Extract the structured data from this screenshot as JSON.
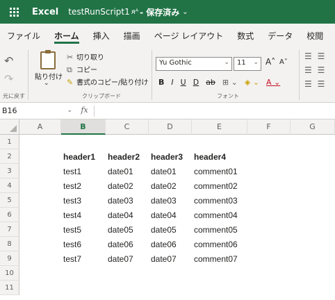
{
  "titlebar": {
    "app": "Excel",
    "doc": "testRunScript1",
    "share_icon": "ᴙᴬ",
    "save_status": "- 保存済み",
    "chevron": "⌄"
  },
  "tabs": [
    "ファイル",
    "ホーム",
    "挿入",
    "描画",
    "ページ レイアウト",
    "数式",
    "データ",
    "校閲"
  ],
  "ribbon": {
    "undo_icon": "↶",
    "redo_icon": "↷",
    "undo_group": "元に戻す",
    "paste": "貼り付け",
    "paste_chev": "⌄",
    "cut": "切り取り",
    "copy": "コピー",
    "format_painter": "書式のコピー/貼り付け",
    "clipboard_group": "クリップボード",
    "font_name": "Yu Gothic",
    "font_size": "11",
    "grow": "A˄",
    "shrink": "A˅",
    "bold": "B",
    "italic": "I",
    "underline": "U",
    "double_underline": "D",
    "strike": "ab",
    "border_icon": "⊞ ⌄",
    "fill_icon": "◈ ⌄",
    "fontcolor_icon": "A ⌄",
    "font_group": "フォント",
    "align_top": "☰ ☰",
    "align_mid": "☰ ☰",
    "align_bot": "☰ ☰"
  },
  "formulabar": {
    "cell": "B16",
    "dd": "⌄",
    "fx": "fx",
    "value": ""
  },
  "columns": [
    "A",
    "B",
    "C",
    "D",
    "E",
    "F",
    "G"
  ],
  "selected_column": "B",
  "rows": [
    "1",
    "2",
    "3",
    "4",
    "5",
    "6",
    "7",
    "8",
    "9",
    "10",
    "11"
  ],
  "table": {
    "headers": [
      "header1",
      "header2",
      "header3",
      "header4"
    ],
    "rows": [
      [
        "test1",
        "date01",
        "date01",
        "comment01"
      ],
      [
        "test2",
        "date02",
        "date02",
        "comment02"
      ],
      [
        "test3",
        "date03",
        "date03",
        "comment03"
      ],
      [
        "test4",
        "date04",
        "date04",
        "comment04"
      ],
      [
        "test5",
        "date05",
        "date05",
        "comment05"
      ],
      [
        "test6",
        "date06",
        "date06",
        "comment06"
      ],
      [
        "test7",
        "date07",
        "date07",
        "comment07"
      ]
    ]
  }
}
